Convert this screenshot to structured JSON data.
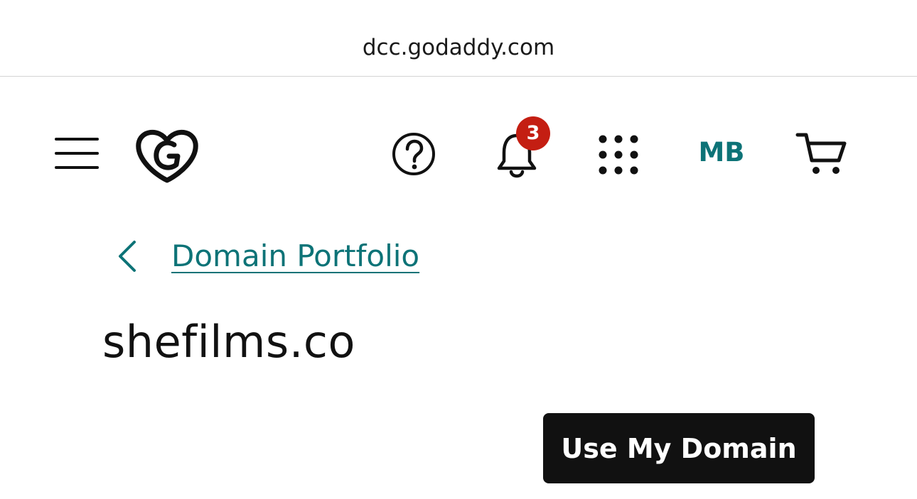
{
  "browser": {
    "url": "dcc.godaddy.com"
  },
  "header": {
    "notifications": {
      "count": "3"
    },
    "account": {
      "initials": "MB"
    },
    "icons": [
      "hamburger-menu-icon",
      "godaddy-logo-icon",
      "help-icon",
      "bell-icon",
      "apps-grid-icon",
      "cart-icon"
    ],
    "accent_color": "#0d7377",
    "badge_color": "#c41e12"
  },
  "breadcrumb": {
    "label": "Domain Portfolio"
  },
  "main": {
    "domain_name": "shefilms.co",
    "primary_action_label": "Use My Domain"
  }
}
